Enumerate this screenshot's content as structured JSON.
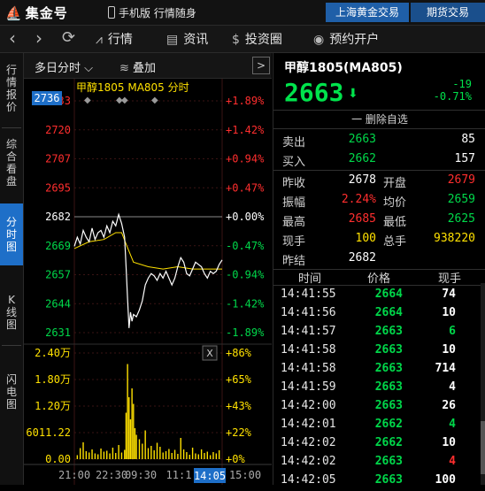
{
  "app": {
    "logo_text": "集金号",
    "mobile_label": "手机版 行情随身",
    "top_buttons": [
      "上海黄金交易",
      "期货交易"
    ]
  },
  "nav": {
    "back_arrow": "chevron-left-icon",
    "forward_arrow": "chevron-right-icon",
    "refresh": "refresh-icon",
    "items": [
      {
        "label": "行情",
        "icon": "chart-icon"
      },
      {
        "label": "资讯",
        "icon": "news-icon"
      },
      {
        "label": "投资圈",
        "icon": "dollar-circle-icon"
      },
      {
        "label": "预约开户",
        "icon": "bell-icon"
      }
    ]
  },
  "sidebar": {
    "tabs": [
      "行情报价",
      "综合看盘",
      "分时图",
      "K线图",
      "闪电图"
    ],
    "active": "分时图"
  },
  "chart_toolbar": {
    "period_label": "多日分时",
    "overlay_label": "叠加",
    "expand_symbol": ">"
  },
  "chart_data": {
    "type": "line",
    "title": "甲醇1805 MA805 分时",
    "price_axis": {
      "left_labels": [
        "2733",
        "2720",
        "2707",
        "2695",
        "2682",
        "2669",
        "2657",
        "2644",
        "2631"
      ],
      "right_labels": [
        "+1.89%",
        "+1.42%",
        "+0.94%",
        "+0.47%",
        "+0.00%",
        "-0.47%",
        "-0.94%",
        "-1.42%",
        "-1.89%"
      ],
      "ylim": [
        2631,
        2733
      ],
      "prev_close": 2682
    },
    "cursor_price_label": "2736",
    "volume_axis": {
      "left_labels": [
        "2.40万",
        "1.80万",
        "1.20万",
        "6011.22",
        "0.00"
      ],
      "right_labels": [
        "+86%",
        "+65%",
        "+43%",
        "+22%",
        "+0%"
      ],
      "ylim": [
        0,
        24000
      ]
    },
    "x_tick_labels": [
      "21:00",
      "22:30",
      "09:30",
      "11:1",
      "13:",
      "15:00"
    ],
    "cursor_time_label": "14:05",
    "close_button": "X",
    "price_series": [
      [
        0,
        2669
      ],
      [
        0.02,
        2673
      ],
      [
        0.04,
        2670
      ],
      [
        0.06,
        2676
      ],
      [
        0.08,
        2673
      ],
      [
        0.1,
        2671
      ],
      [
        0.12,
        2677
      ],
      [
        0.14,
        2672
      ],
      [
        0.16,
        2675
      ],
      [
        0.18,
        2676
      ],
      [
        0.2,
        2673
      ],
      [
        0.22,
        2678
      ],
      [
        0.24,
        2675
      ],
      [
        0.26,
        2680
      ],
      [
        0.28,
        2678
      ],
      [
        0.3,
        2683
      ],
      [
        0.32,
        2679
      ],
      [
        0.34,
        2673
      ],
      [
        0.35,
        2660
      ],
      [
        0.36,
        2646
      ],
      [
        0.37,
        2633
      ],
      [
        0.38,
        2640
      ],
      [
        0.39,
        2636
      ],
      [
        0.4,
        2639
      ],
      [
        0.42,
        2638
      ],
      [
        0.44,
        2641
      ],
      [
        0.46,
        2645
      ],
      [
        0.48,
        2652
      ],
      [
        0.5,
        2655
      ],
      [
        0.52,
        2657
      ],
      [
        0.54,
        2656
      ],
      [
        0.56,
        2654
      ],
      [
        0.58,
        2657
      ],
      [
        0.6,
        2655
      ],
      [
        0.62,
        2658
      ],
      [
        0.64,
        2655
      ],
      [
        0.66,
        2652
      ],
      [
        0.68,
        2655
      ],
      [
        0.7,
        2660
      ],
      [
        0.72,
        2664
      ],
      [
        0.74,
        2662
      ],
      [
        0.76,
        2657
      ],
      [
        0.78,
        2656
      ],
      [
        0.8,
        2659
      ],
      [
        0.82,
        2662
      ],
      [
        0.84,
        2661
      ],
      [
        0.86,
        2660
      ],
      [
        0.88,
        2657
      ],
      [
        0.9,
        2655
      ],
      [
        0.92,
        2658
      ],
      [
        0.94,
        2657
      ],
      [
        0.96,
        2658
      ],
      [
        0.98,
        2661
      ],
      [
        1.0,
        2663
      ]
    ],
    "avg_series": [
      [
        0,
        2668
      ],
      [
        0.1,
        2671
      ],
      [
        0.2,
        2672
      ],
      [
        0.28,
        2675
      ],
      [
        0.32,
        2675
      ],
      [
        0.35,
        2670
      ],
      [
        0.4,
        2662
      ],
      [
        0.5,
        2660
      ],
      [
        0.6,
        2659
      ],
      [
        0.7,
        2660
      ],
      [
        0.8,
        2659
      ],
      [
        0.9,
        2659
      ],
      [
        1.0,
        2659
      ]
    ],
    "volume_series": [
      [
        0.02,
        900
      ],
      [
        0.04,
        2500
      ],
      [
        0.06,
        3800
      ],
      [
        0.08,
        1800
      ],
      [
        0.1,
        1500
      ],
      [
        0.12,
        2200
      ],
      [
        0.14,
        1300
      ],
      [
        0.16,
        1100
      ],
      [
        0.18,
        2400
      ],
      [
        0.2,
        1700
      ],
      [
        0.22,
        1900
      ],
      [
        0.24,
        1300
      ],
      [
        0.26,
        2600
      ],
      [
        0.28,
        1400
      ],
      [
        0.3,
        3200
      ],
      [
        0.32,
        1500
      ],
      [
        0.34,
        2100
      ],
      [
        0.35,
        10500
      ],
      [
        0.36,
        21500
      ],
      [
        0.37,
        14000
      ],
      [
        0.38,
        9000
      ],
      [
        0.39,
        16000
      ],
      [
        0.4,
        12500
      ],
      [
        0.41,
        7000
      ],
      [
        0.42,
        5500
      ],
      [
        0.44,
        4500
      ],
      [
        0.46,
        3500
      ],
      [
        0.48,
        6500
      ],
      [
        0.5,
        2500
      ],
      [
        0.52,
        3000
      ],
      [
        0.54,
        2000
      ],
      [
        0.56,
        3700
      ],
      [
        0.58,
        2800
      ],
      [
        0.6,
        1500
      ],
      [
        0.62,
        1800
      ],
      [
        0.64,
        2300
      ],
      [
        0.66,
        1400
      ],
      [
        0.68,
        2100
      ],
      [
        0.7,
        1200
      ],
      [
        0.72,
        4800
      ],
      [
        0.74,
        2200
      ],
      [
        0.76,
        1600
      ],
      [
        0.78,
        1000
      ],
      [
        0.8,
        2600
      ],
      [
        0.82,
        1300
      ],
      [
        0.84,
        1100
      ],
      [
        0.86,
        2200
      ],
      [
        0.88,
        1400
      ],
      [
        0.9,
        1700
      ],
      [
        0.92,
        900
      ],
      [
        0.94,
        1600
      ],
      [
        0.96,
        1300
      ],
      [
        0.98,
        2000
      ]
    ]
  },
  "quote": {
    "name": "甲醇1805(MA805)",
    "price": "2663",
    "change": "-19",
    "change_pct": "-0.71%",
    "delete_fav": "一 删除自选",
    "rows": [
      {
        "l1": "卖出",
        "v1": "2663",
        "c1": "green",
        "l2": "",
        "v2": "85",
        "c2": "white"
      },
      {
        "l1": "买入",
        "v1": "2662",
        "c1": "green",
        "l2": "",
        "v2": "157",
        "c2": "white"
      },
      {
        "l1": "昨收",
        "v1": "2678",
        "c1": "white",
        "l2": "开盘",
        "v2": "2679",
        "c2": "red"
      },
      {
        "l1": "振幅",
        "v1": "2.24%",
        "c1": "red",
        "l2": "均价",
        "v2": "2659",
        "c2": "green"
      },
      {
        "l1": "最高",
        "v1": "2685",
        "c1": "red",
        "l2": "最低",
        "v2": "2625",
        "c2": "green"
      },
      {
        "l1": "现手",
        "v1": "100",
        "c1": "yellow",
        "l2": "总手",
        "v2": "938220",
        "c2": "yellow"
      },
      {
        "l1": "昨结",
        "v1": "2682",
        "c1": "white",
        "l2": "",
        "v2": "",
        "c2": "white"
      }
    ]
  },
  "ticks": {
    "headers": [
      "时间",
      "价格",
      "现手"
    ],
    "rows": [
      {
        "time": "14:41:55",
        "price": "2664",
        "pc": "green",
        "vol": "74",
        "vc": "white"
      },
      {
        "time": "14:41:56",
        "price": "2664",
        "pc": "green",
        "vol": "10",
        "vc": "white"
      },
      {
        "time": "14:41:57",
        "price": "2663",
        "pc": "green",
        "vol": "6",
        "vc": "green"
      },
      {
        "time": "14:41:58",
        "price": "2663",
        "pc": "green",
        "vol": "10",
        "vc": "white"
      },
      {
        "time": "14:41:58",
        "price": "2663",
        "pc": "green",
        "vol": "714",
        "vc": "white"
      },
      {
        "time": "14:41:59",
        "price": "2663",
        "pc": "green",
        "vol": "4",
        "vc": "white"
      },
      {
        "time": "14:42:00",
        "price": "2663",
        "pc": "green",
        "vol": "26",
        "vc": "white"
      },
      {
        "time": "14:42:01",
        "price": "2662",
        "pc": "green",
        "vol": "4",
        "vc": "green"
      },
      {
        "time": "14:42:02",
        "price": "2662",
        "pc": "green",
        "vol": "10",
        "vc": "white"
      },
      {
        "time": "14:42:02",
        "price": "2663",
        "pc": "green",
        "vol": "4",
        "vc": "red"
      },
      {
        "time": "14:42:05",
        "price": "2663",
        "pc": "green",
        "vol": "100",
        "vc": "white"
      }
    ]
  },
  "colors": {
    "up": "#ff2e2e",
    "down": "#00d84a",
    "accent": "#1e6fc8",
    "price_line": "#ffffff",
    "avg_line": "#ffe100",
    "volume": "#ffe100"
  }
}
